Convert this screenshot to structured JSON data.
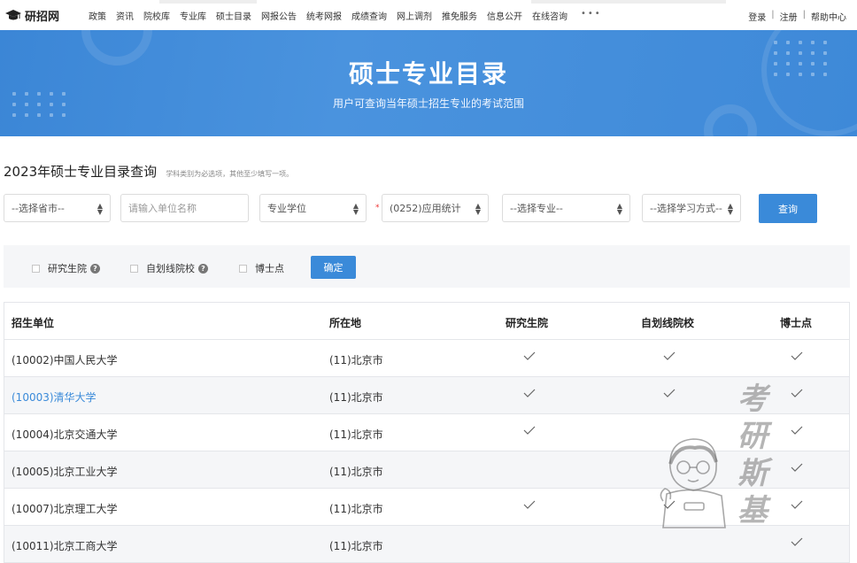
{
  "nav": {
    "logo_text": "研招网",
    "items": [
      "政策",
      "资讯",
      "院校库",
      "专业库",
      "硕士目录",
      "网报公告",
      "统考网报",
      "成绩查询",
      "网上调剂",
      "推免服务",
      "信息公开",
      "在线咨询"
    ],
    "more": "•••",
    "login": "登录",
    "register": "注册",
    "help": "帮助中心"
  },
  "banner": {
    "title": "硕士专业目录",
    "subtitle": "用户可查询当年硕士招生专业的考试范围"
  },
  "search": {
    "title": "2023年硕士专业目录查询",
    "hint": "学科类别为必选项，其他至少填写一项。",
    "province": "--选择省市--",
    "unit_placeholder": "请输入单位名称",
    "degree_type": "专业学位",
    "required_mark": "*",
    "category": "(0252)应用统计",
    "major": "--选择专业--",
    "study_mode": "--选择学习方式--",
    "query_button": "查询"
  },
  "filters": {
    "options": [
      {
        "label": "研究生院",
        "checked": false,
        "help": true
      },
      {
        "label": "自划线院校",
        "checked": false,
        "help": true
      },
      {
        "label": "博士点",
        "checked": false,
        "help": false
      }
    ],
    "confirm_button": "确定",
    "help_icon_glyph": "?"
  },
  "table": {
    "columns": [
      "招生单位",
      "所在地",
      "研究生院",
      "自划线院校",
      "博士点"
    ],
    "rows": [
      {
        "unit": "(10002)中国人民大学",
        "location": "(11)北京市",
        "grad_school": true,
        "self_line": true,
        "doctoral": true,
        "highlight": false
      },
      {
        "unit": "(10003)清华大学",
        "location": "(11)北京市",
        "grad_school": true,
        "self_line": true,
        "doctoral": true,
        "highlight": true
      },
      {
        "unit": "(10004)北京交通大学",
        "location": "(11)北京市",
        "grad_school": true,
        "self_line": false,
        "doctoral": true,
        "highlight": false
      },
      {
        "unit": "(10005)北京工业大学",
        "location": "(11)北京市",
        "grad_school": false,
        "self_line": false,
        "doctoral": true,
        "highlight": false
      },
      {
        "unit": "(10007)北京理工大学",
        "location": "(11)北京市",
        "grad_school": true,
        "self_line": true,
        "doctoral": true,
        "highlight": false
      },
      {
        "unit": "(10011)北京工商大学",
        "location": "(11)北京市",
        "grad_school": false,
        "self_line": false,
        "doctoral": true,
        "highlight": false
      }
    ]
  },
  "watermark": {
    "text": [
      "考",
      "研",
      "斯",
      "基"
    ]
  },
  "colors": {
    "accent": "#3a8ad9",
    "banner": "#3e89d8",
    "link": "#3a8ad9"
  }
}
